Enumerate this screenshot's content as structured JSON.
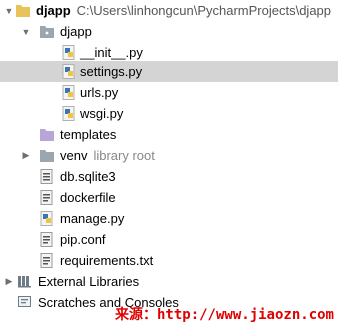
{
  "project": {
    "name": "djapp",
    "path": "C:\\Users\\linhongcun\\PycharmProjects\\djapp"
  },
  "tree": {
    "package_name": "djapp",
    "init_file": "__init__.py",
    "settings_file": "settings.py",
    "urls_file": "urls.py",
    "wsgi_file": "wsgi.py",
    "templates_folder": "templates",
    "venv_folder": "venv",
    "venv_hint": "library root",
    "db_file": "db.sqlite3",
    "dockerfile": "dockerfile",
    "manage_file": "manage.py",
    "pip_conf": "pip.conf",
    "requirements": "requirements.txt",
    "external_libraries": "External Libraries",
    "scratches": "Scratches and Consoles"
  },
  "watermark": {
    "source_label": "来源：",
    "url": "http://www.jiaozn.com"
  },
  "colors": {
    "folder": "#e8c35a",
    "package_folder": "#9aa7b0",
    "selection": "#d4d4d4",
    "python_blue": "#3a75b0",
    "python_yellow": "#f0c640"
  }
}
